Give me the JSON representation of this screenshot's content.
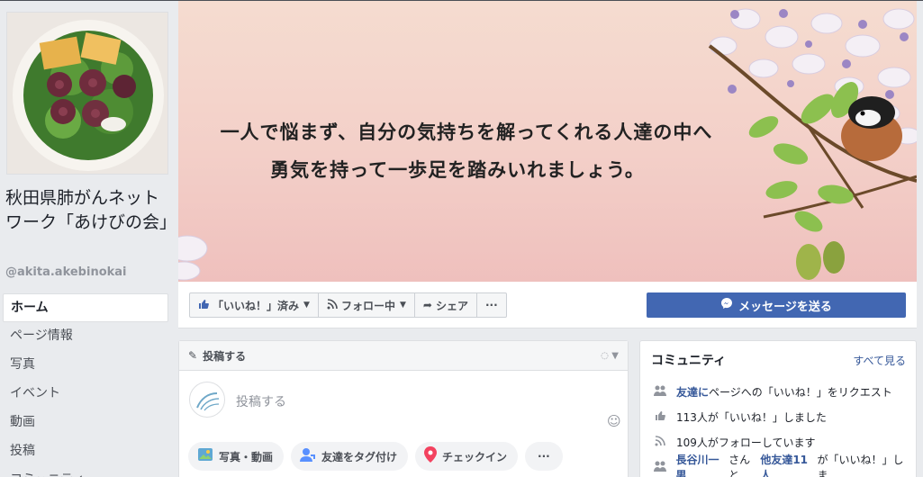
{
  "page": {
    "name": "秋田県肺がんネットワーク「あけびの会」",
    "handle": "@akita.akebinokai"
  },
  "nav": {
    "items": [
      {
        "label": "ホーム",
        "active": true
      },
      {
        "label": "ページ情報"
      },
      {
        "label": "写真"
      },
      {
        "label": "イベント"
      },
      {
        "label": "動画"
      },
      {
        "label": "投稿"
      },
      {
        "label": "コミュニティ"
      }
    ]
  },
  "cover": {
    "line1": "一人で悩まず、自分の気持ちを解ってくれる人達の中へ",
    "line2": "勇気を持って一歩足を踏みいれましょう。"
  },
  "actions": {
    "like_label": "「いいね！」済み",
    "follow_label": "フォロー中",
    "share_label": "シェア",
    "more_label": "···",
    "message_label": "メッセージを送る"
  },
  "post": {
    "header": "投稿する",
    "placeholder": "投稿する",
    "photo_video": "写真・動画",
    "tag_friends": "友達をタグ付け",
    "check_in": "チェックイン",
    "more": "···"
  },
  "community": {
    "title": "コミュニティ",
    "see_all": "すべて見る",
    "row1_link": "友達に",
    "row1_text": "ページへの「いいね！」をリクエスト",
    "row2_text": "113人が「いいね！」しました",
    "row3_text": "109人がフォローしています",
    "row4_name": "長谷川一男",
    "row4_mid": "さんと",
    "row4_others": "他友達11人",
    "row4_text": "が「いいね！」しま"
  },
  "colors": {
    "accent": "#4267b2",
    "link": "#365899",
    "background": "#e9ebee"
  }
}
